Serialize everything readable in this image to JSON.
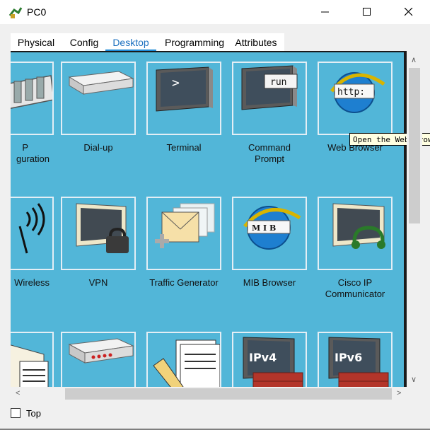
{
  "window": {
    "title": "PC0",
    "minimize_icon": "minimize-icon",
    "maximize_icon": "maximize-icon",
    "close_icon": "close-icon"
  },
  "tabs": [
    {
      "label": "Physical",
      "active": false
    },
    {
      "label": "Config",
      "active": false
    },
    {
      "label": "Desktop",
      "active": true
    },
    {
      "label": "Programming",
      "active": false
    },
    {
      "label": "Attributes",
      "active": false
    }
  ],
  "apps": {
    "ip_config": {
      "line1": "P",
      "line2": "guration"
    },
    "dialup": {
      "line1": "Dial-up"
    },
    "terminal": {
      "line1": "Terminal",
      "icon_text": ">"
    },
    "command_prompt": {
      "line1": "Command",
      "line2": "Prompt",
      "icon_text": "run"
    },
    "web_browser": {
      "line1": "Web Browser",
      "icon_text": "http:"
    },
    "wireless": {
      "line1": "Wireless"
    },
    "vpn": {
      "line1": "VPN"
    },
    "traffic_generator": {
      "line1": "Traffic Generator"
    },
    "mib_browser": {
      "line1": "MIB Browser",
      "icon_text": "M I B"
    },
    "cisco_ip_communicator": {
      "line1": "Cisco IP",
      "line2": "Communicator"
    },
    "ipv4_firewall": {
      "icon_text": "IPv4"
    },
    "ipv6_firewall": {
      "icon_text": "IPv6"
    }
  },
  "tooltip": {
    "text": "Open the Web Browser"
  },
  "footer": {
    "top_label": "Top",
    "top_checked": false
  },
  "colors": {
    "desktop_bg": "#52b6d8",
    "tile_border": "#e3eef5",
    "active_tab": "#1f72c0"
  }
}
